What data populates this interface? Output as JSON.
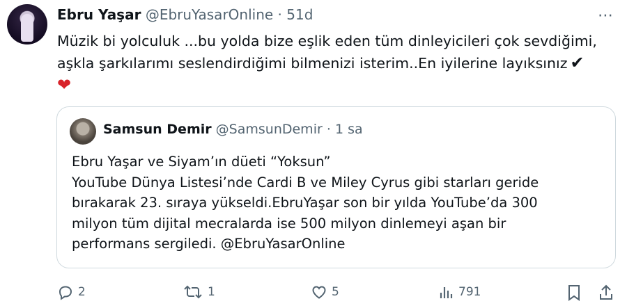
{
  "tweet": {
    "author_name": "Ebru Yaşar",
    "handle": "@EbruYasarOnline",
    "separator": "·",
    "time": "51d",
    "text_lines": [
      "Müzik bi yolculuk ...bu yolda bize eşlik eden tüm dinleyicileri çok sevdiğimi,",
      "aşkla şarkılarımı seslendirdiğimi bilmenizi isterim..En iyilerine layıksınız"
    ],
    "check_emoji": "✔",
    "heart_emoji": "❤"
  },
  "quote": {
    "author_name": "Samsun Demir",
    "handle": "@SamsunDemir",
    "separator": "·",
    "time": "1 sa",
    "text_lines": [
      "Ebru Yaşar ve Siyam’ın düeti “Yoksun”",
      "YouTube Dünya Listesi’nde Cardi B ve Miley Cyrus gibi starları geride",
      "bırakarak 23. sıraya yükseldi.EbruYaşar son bir yılda YouTube’da 300",
      "milyon tüm dijital mecralarda ise 500 milyon dinlemeyi aşan bir",
      "performans sergiledi. @EbruYasarOnline"
    ]
  },
  "actions": {
    "reply_count": "2",
    "retweet_count": "1",
    "like_count": "5",
    "views_count": "791"
  },
  "colors": {
    "text": "#0f1419",
    "muted": "#536471",
    "border": "#cfd9de",
    "heart": "#d8232a"
  }
}
